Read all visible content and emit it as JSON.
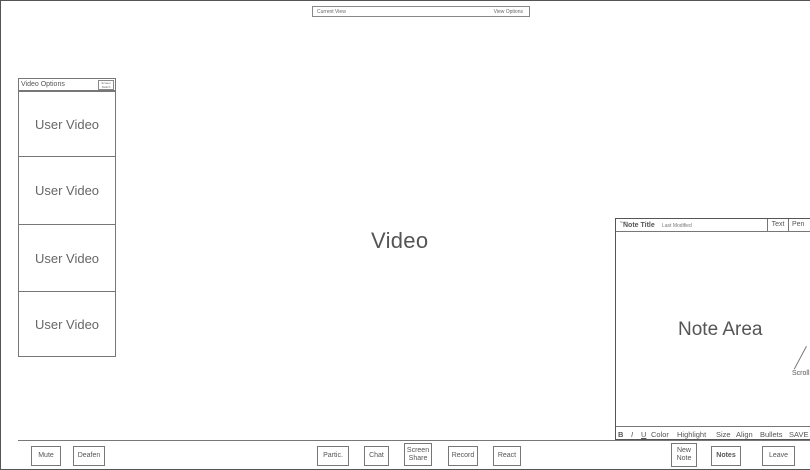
{
  "top_bar": {
    "current_view": "Current View",
    "view_options": "View Options"
  },
  "video_panel": {
    "options_label": "Video Options",
    "switch_label": "Screen Switch",
    "tiles": [
      "User Video",
      "User Video",
      "User Video",
      "User Video"
    ]
  },
  "main": {
    "video_label": "Video"
  },
  "notes": {
    "tiny_label": "Notes",
    "title": "Note Title",
    "last_modified": "Last Modified",
    "text_button": "Text",
    "pen_button": "Pen",
    "area_label": "Note Area",
    "scroll_label": "Scroll",
    "format": {
      "bold": "B",
      "italic": "I",
      "underline": "U",
      "color": "Color",
      "highlight": "Highlight",
      "size": "Size",
      "align": "Align",
      "bullets": "Bullets",
      "save": "SAVE"
    }
  },
  "bottom_bar": {
    "mute": "Mute",
    "deafen": "Deafen",
    "participants": "Partic.",
    "chat": "Chat",
    "screen_share": "Screen Share",
    "record": "Record",
    "react": "React",
    "new_note": "New Note",
    "notes": "Notes",
    "leave": "Leave"
  }
}
